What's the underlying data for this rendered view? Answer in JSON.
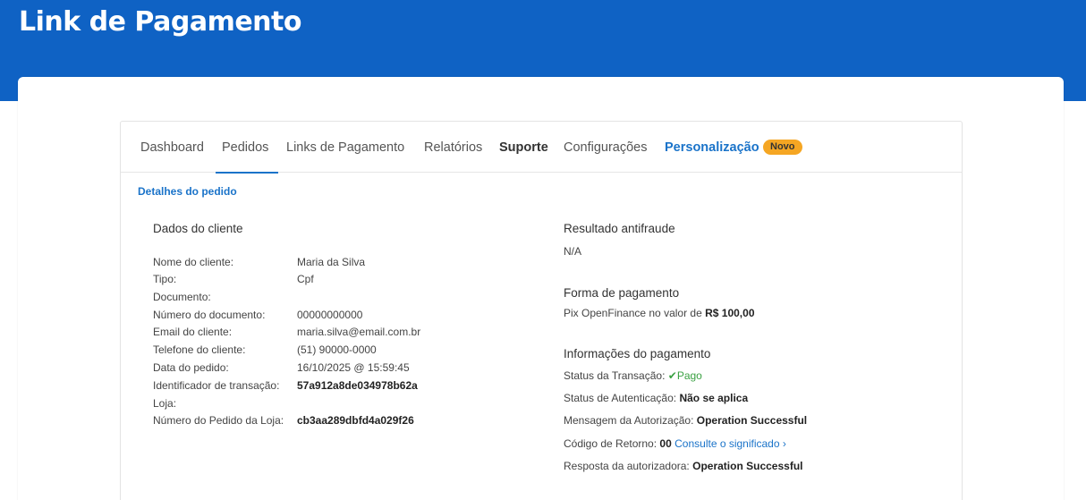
{
  "header": {
    "title": "Link de Pagamento"
  },
  "nav": {
    "tabs": [
      {
        "label": "Dashboard"
      },
      {
        "label": "Pedidos"
      },
      {
        "label": "Links de Pagamento"
      },
      {
        "label": "Relatórios"
      },
      {
        "label": "Suporte"
      },
      {
        "label": "Configurações"
      },
      {
        "label": "Personalização"
      }
    ],
    "active_tab": "Pedidos",
    "badge": "Novo"
  },
  "section_title": "Detalhes do pedido",
  "cliente": {
    "heading": "Dados do cliente",
    "fields": [
      {
        "label": "Nome do cliente:",
        "value": "Maria da Silva"
      },
      {
        "label": "Tipo:",
        "value": "Cpf"
      },
      {
        "label": "Documento:",
        "value": ""
      },
      {
        "label": "Número do documento:",
        "value": "00000000000"
      },
      {
        "label": "Email do cliente:",
        "value": "maria.silva@email.com.br"
      },
      {
        "label": "Telefone do cliente:",
        "value": "(51) 90000-0000"
      },
      {
        "label": "Data do pedido:",
        "value": "16/10/2025 @ 15:59:45"
      },
      {
        "label": "Identificador de transação:",
        "value": "57a912a8de034978b62a"
      },
      {
        "label": "Loja:",
        "value": ""
      },
      {
        "label": "Número do Pedido da Loja:",
        "value": "cb3aa289dbfd4a029f26"
      }
    ]
  },
  "antifraude": {
    "heading": "Resultado antifraude",
    "value": "N/A"
  },
  "forma_pagamento": {
    "heading": "Forma de pagamento",
    "text": "Pix OpenFinance no valor de",
    "amount": "R$ 100,00"
  },
  "info_pagamento": {
    "heading": "Informações do pagamento",
    "status_label": "Status da Transação:",
    "status_icon": "check-icon",
    "status_value": "Pago",
    "status_color": "#3aa142",
    "auth_label": "Status de Autenticação:",
    "auth_value": "Não se aplica",
    "msg_label": "Mensagem da Autorização:",
    "msg_value": "Operation Successful",
    "code_label": "Código de Retorno:",
    "code_value": "00",
    "code_link": "Consulte o significado",
    "resp_label": "Resposta da autorizadora:",
    "resp_value": "Operation Successful"
  },
  "colors": {
    "brand": "#0f62c4",
    "accent": "#1a73c9",
    "badge": "#f5a623"
  }
}
